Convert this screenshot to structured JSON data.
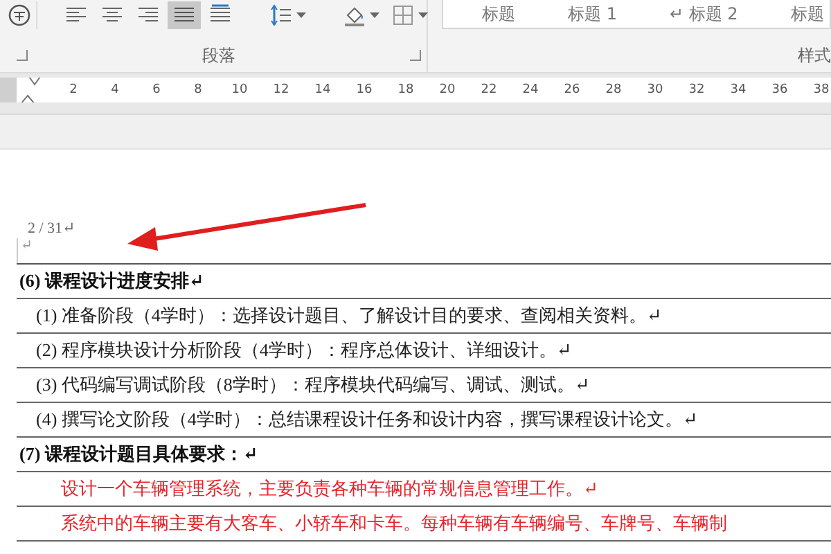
{
  "ribbon": {
    "paragraph_group": {
      "label": "段落",
      "buttons": [
        {
          "kind": "circle",
          "selected": false,
          "dropdown": false
        },
        {
          "kind": "align-left",
          "selected": false,
          "dropdown": false
        },
        {
          "kind": "align-center",
          "selected": false,
          "dropdown": false
        },
        {
          "kind": "align-right",
          "selected": false,
          "dropdown": false
        },
        {
          "kind": "justify",
          "selected": true,
          "dropdown": false
        },
        {
          "kind": "distributed",
          "selected": false,
          "dropdown": false
        },
        {
          "kind": "line-spacing",
          "selected": false,
          "dropdown": true
        },
        {
          "kind": "shading",
          "selected": false,
          "dropdown": true
        },
        {
          "kind": "borders",
          "selected": false,
          "dropdown": true
        }
      ]
    },
    "styles_group": {
      "label": "样式",
      "items": [
        "标题",
        "标题 1",
        "↵ 标题 2",
        "标题"
      ]
    }
  },
  "ruler": {
    "numbers": [
      "2",
      "4",
      "6",
      "8",
      "10",
      "12",
      "14",
      "16",
      "18",
      "20",
      "22",
      "24",
      "26",
      "28",
      "30",
      "32",
      "34",
      "36",
      "38"
    ]
  },
  "document": {
    "page_number": "2 / 31↵",
    "empty_paragraph": "↵",
    "rows": [
      {
        "kind": "heading",
        "text": "(6) 课程设计进度安排↵"
      },
      {
        "kind": "item",
        "text": "(1) 准备阶段（4学时）：选择设计题目、了解设计目的要求、查阅相关资料。↵"
      },
      {
        "kind": "item",
        "text": "(2) 程序模块设计分析阶段（4学时）：程序总体设计、详细设计。↵"
      },
      {
        "kind": "item",
        "text": "(3) 代码编写调试阶段（8学时）：程序模块代码编写、调试、测试。↵"
      },
      {
        "kind": "item",
        "text": "(4) 撰写论文阶段（4学时）：总结课程设计任务和设计内容，撰写课程设计论文。↵"
      },
      {
        "kind": "heading",
        "text": "(7) 课程设计题目具体要求：↵"
      },
      {
        "kind": "requirement",
        "text": "设计一个车辆管理系统，主要负责各种车辆的常规信息管理工作。↵"
      },
      {
        "kind": "requirement",
        "text": "系统中的车辆主要有大客车、小轿车和卡车。每种车辆有车辆编号、车牌号、车辆制"
      }
    ]
  }
}
